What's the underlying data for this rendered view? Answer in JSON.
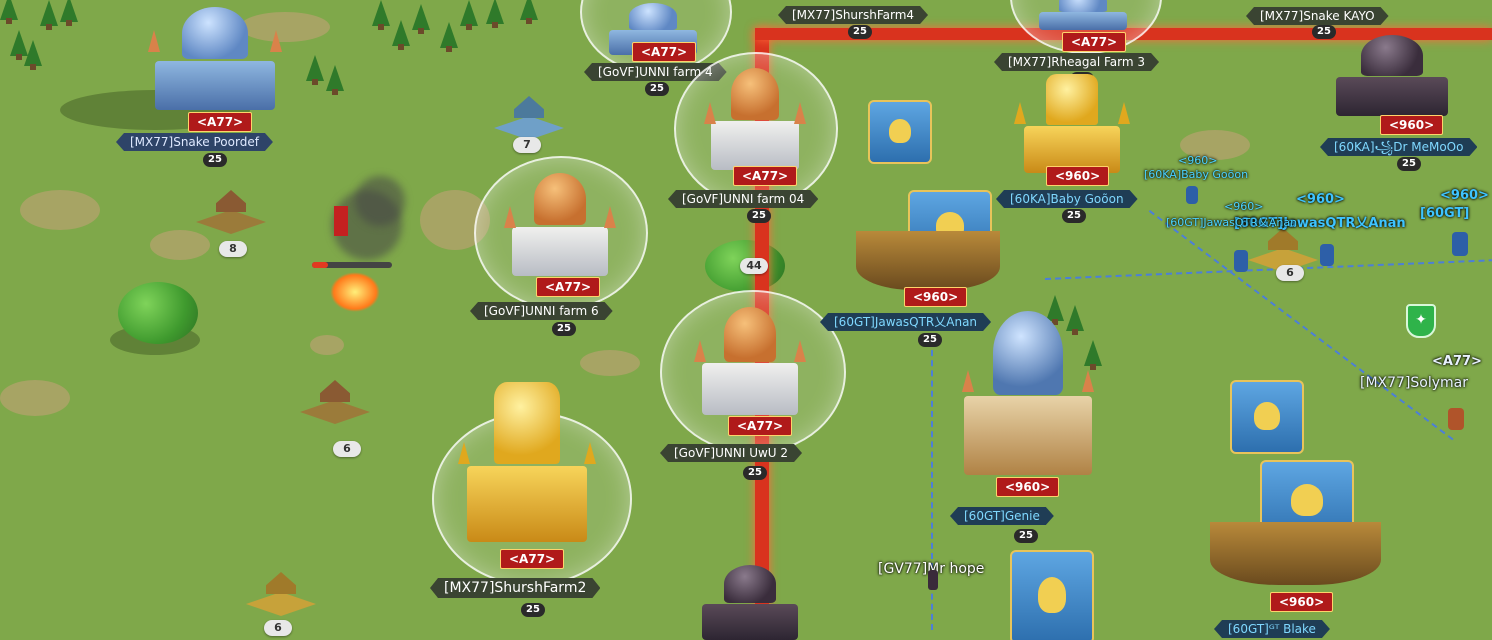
{
  "colors": {
    "grass": "#7fa84a",
    "route": "#d9331e",
    "tag_red": "#b01a1a",
    "march_line": "#4c7fd8"
  },
  "cities": [
    {
      "name": "[MX77]Snake Poordef",
      "alliance_tag": "<A77>",
      "level": "25"
    },
    {
      "name": "[GoVF]UNNI farm 4",
      "alliance_tag": "<A77>",
      "level": "25"
    },
    {
      "name": "[GoVF]UNNI farm 04",
      "alliance_tag": "<A77>",
      "level": "25"
    },
    {
      "name": "[GoVF]UNNI farm 6",
      "alliance_tag": "<A77>",
      "level": "25"
    },
    {
      "name": "[GoVF]UNNI UwU 2",
      "alliance_tag": "<A77>",
      "level": "25"
    },
    {
      "name": "[MX77]ShurshFarm2",
      "alliance_tag": "<A77>",
      "level": "25"
    },
    {
      "name": "[MX77]ShurshFarm4",
      "level": "25"
    },
    {
      "name": "[MX77]Rheagal Farm 3",
      "alliance_tag": "<A77>",
      "level": "25"
    },
    {
      "name": "[MX77]Snake KAYO",
      "level": "25"
    },
    {
      "name": "[60KA]Baby Goõon",
      "alliance_tag": "<960>",
      "level": "25"
    },
    {
      "name": "[60KA]꧁Dr MeMoOo",
      "alliance_tag": "<960>",
      "level": "25"
    },
    {
      "name": "[60GT]JawasQTR乂Anan",
      "alliance_tag": "<960>",
      "level": "25"
    },
    {
      "name": "[60GT]Genie",
      "alliance_tag": "<960>",
      "level": "25"
    },
    {
      "name": "[60GT]ᴳᵀ Blake",
      "alliance_tag": "<960>"
    },
    {
      "name": "[MX77]Solymar",
      "alliance_tag": "<A77>"
    }
  ],
  "resource_badges": [
    "7",
    "8",
    "6",
    "6",
    "44",
    "6"
  ],
  "troops": [
    {
      "label": "[GV77]Mr hope"
    },
    {
      "label": "[60KA]Baby Goõon",
      "tag": "<960>"
    },
    {
      "label": "[60GT]JawasQTR乂Anan",
      "tag": "<960>"
    },
    {
      "label": "[60GT]JawasQTR乂Anan",
      "tag": "<960>"
    },
    {
      "label": "[60GT]",
      "tag": "<960>"
    }
  ],
  "icons": {
    "shield": "shield-icon",
    "battle": "battle-icon"
  }
}
